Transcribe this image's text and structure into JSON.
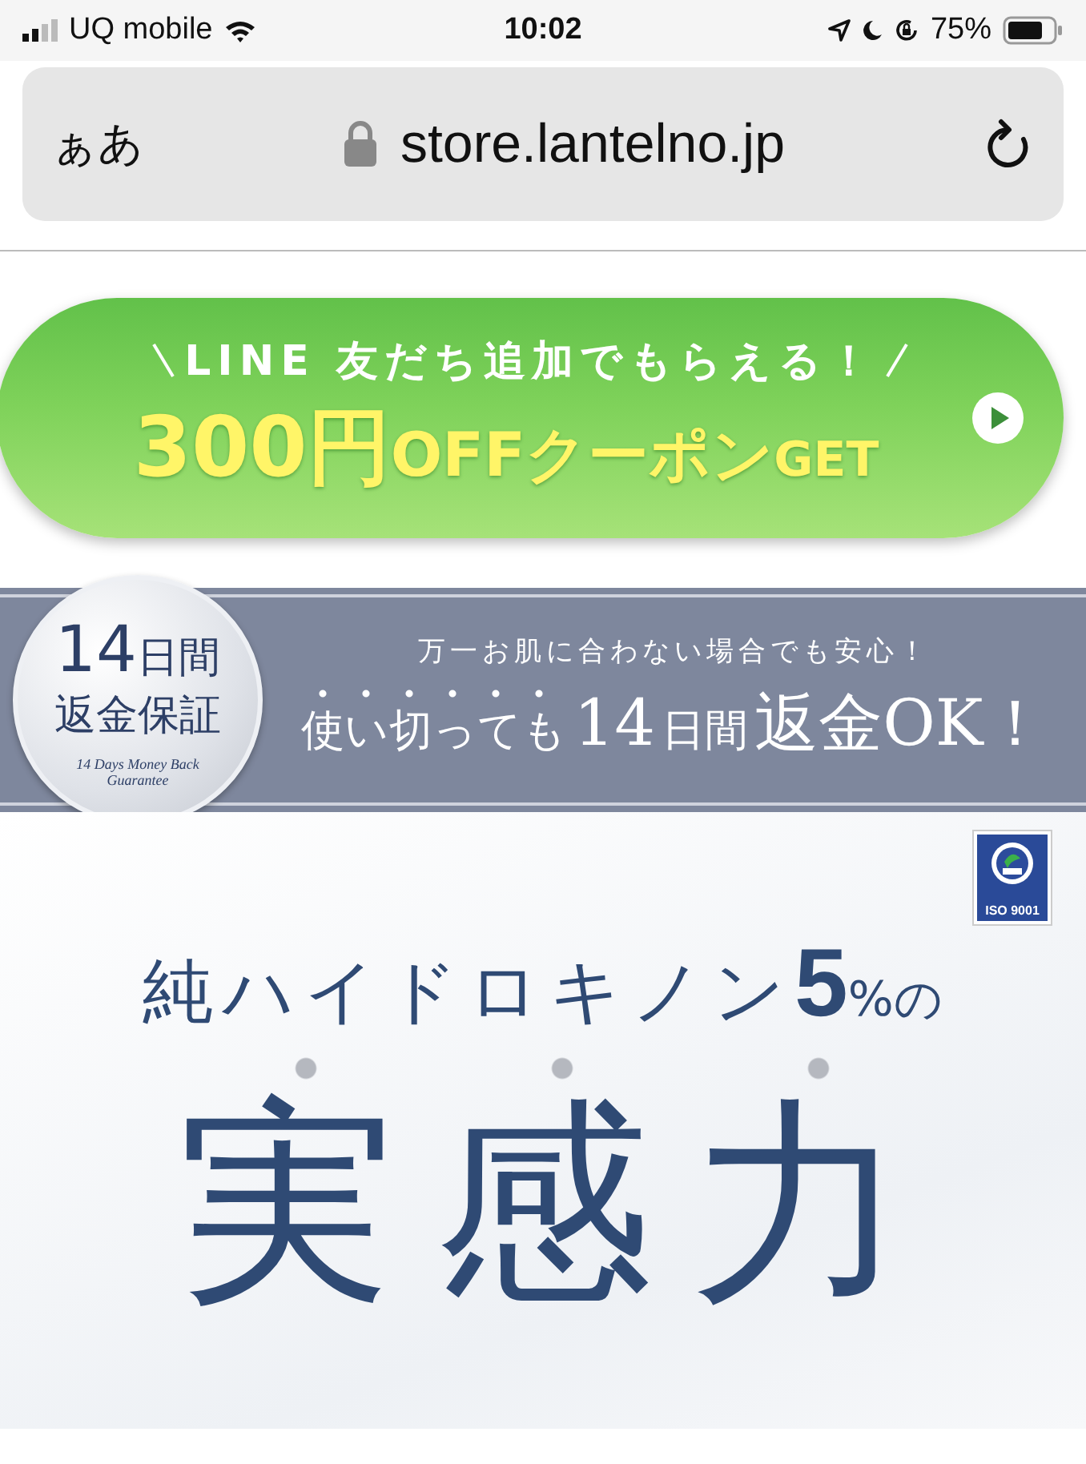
{
  "status_bar": {
    "carrier": "UQ mobile",
    "time": "10:02",
    "battery": "75%"
  },
  "address_bar": {
    "text_size": "ぁあ",
    "url": "store.lantelno.jp"
  },
  "line_banner": {
    "tagline": "LINE 友だち追加でもらえる！",
    "offer": [
      {
        "text": "300円",
        "kind": "large"
      },
      {
        "text": "OFFクーポン",
        "kind": "medium"
      },
      {
        "text": "GET",
        "kind": "small"
      }
    ]
  },
  "guarantee": {
    "badge_number": "14",
    "badge_unit": "日間",
    "badge_title": "返金保証",
    "badge_caption": "14 Days Money Back Guarantee",
    "subtitle": "万一お肌に合わない場合でも安心！",
    "headline": [
      {
        "text": "使い切っても",
        "kind": "medium",
        "emphasis": true
      },
      {
        "text": "14",
        "kind": "large",
        "emphasis": false
      },
      {
        "text": "日間",
        "kind": "medium",
        "emphasis": false
      },
      {
        "text": "返金OK！",
        "kind": "large",
        "emphasis": false
      }
    ]
  },
  "hero": {
    "certification": "ISO 9001",
    "heading": [
      {
        "text": "純ハイドロキノン",
        "kind": "medium"
      },
      {
        "text": "5",
        "kind": "large"
      },
      {
        "text": "%の",
        "kind": "small"
      }
    ],
    "title": "実感力",
    "title_emphasis": true
  }
}
